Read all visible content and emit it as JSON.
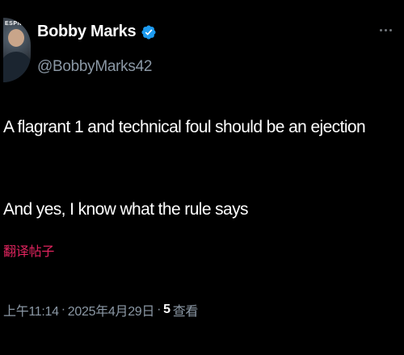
{
  "author": {
    "display_name": "Bobby Marks",
    "handle": "@BobbyMarks42",
    "verified": true,
    "avatar_icon": "profile-photo",
    "avatar_logo_text": "ESPN"
  },
  "tweet": {
    "line1": "A flagrant 1 and technical foul should be an ejection",
    "line2": "And yes, I know what the rule says",
    "translate_label": "翻译帖子"
  },
  "meta": {
    "time": "上午11:14",
    "separator": "·",
    "date": "2025年4月29日",
    "views_count": "5",
    "views_label": "查看"
  },
  "colors": {
    "background": "#000000",
    "text_primary": "#ffffff",
    "text_secondary": "#8b98a5",
    "translate_link": "#e0245e",
    "verified_badge": "#1d9bf0"
  },
  "icons": [
    "verified-badge-icon",
    "more-options-icon"
  ]
}
